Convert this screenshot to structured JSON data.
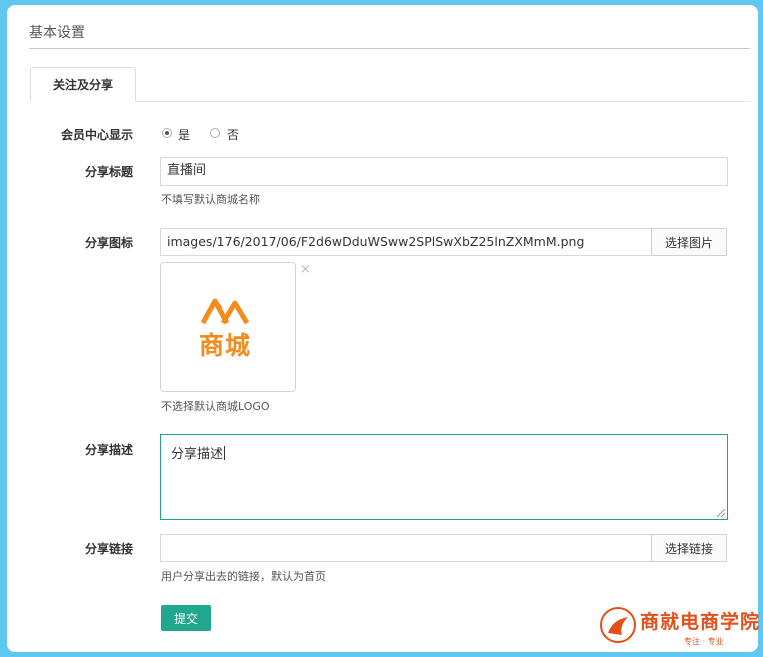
{
  "header": {
    "title": "基本设置"
  },
  "tabs": [
    {
      "label": "关注及分享"
    }
  ],
  "form": {
    "member_center": {
      "label": "会员中心显示",
      "options": [
        {
          "label": "是",
          "checked": true
        },
        {
          "label": "否",
          "checked": false
        }
      ]
    },
    "share_title": {
      "label": "分享标题",
      "value": "直播间",
      "help": "不填写默认商城名称"
    },
    "share_icon": {
      "label": "分享图标",
      "value": "images/176/2017/06/F2d6wDduWSww2SPlSwXbZ25lnZXMmM.png",
      "button": "选择图片",
      "remove": "×",
      "logo_text": "商城",
      "help": "不选择默认商城LOGO"
    },
    "share_desc": {
      "label": "分享描述",
      "value": "分享描述"
    },
    "share_link": {
      "label": "分享链接",
      "value": "",
      "button": "选择链接",
      "help": "用户分享出去的链接，默认为首页"
    },
    "submit": "提交"
  },
  "watermark": {
    "text": "商就电商学院",
    "sub": "专注 · 专业"
  },
  "colors": {
    "accent": "#1fa88e",
    "background": "#5ec8f0",
    "logo_orange": "#f28c1e",
    "watermark": "#e3501b"
  }
}
